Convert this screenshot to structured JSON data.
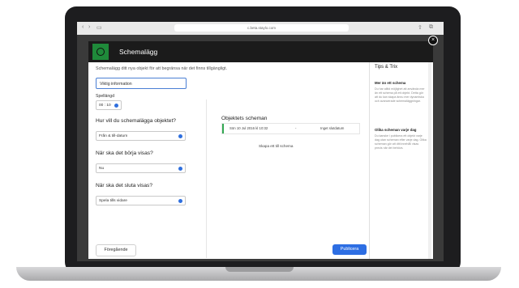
{
  "browser": {
    "address": "c.beta.staylo.com"
  },
  "modal": {
    "title": "Schemalägg",
    "intro": "Schemalägg ditt nya objekt för att begränsa när det finns tillgängligt.",
    "name_value": "Viktig information",
    "duration_label": "Spellängd",
    "duration_value": "00 : 10",
    "q1": "Hur vill du schemalägga objektet?",
    "q1_value": "Från & till-datum",
    "q2": "När ska det börja visas?",
    "q2_value": "Nu",
    "q3": "När ska det sluta visas?",
    "q3_value": "Spela tills vidare",
    "schedules_title": "Objektets scheman",
    "schedule_row": {
      "start": "Sön 10 Jul 2016 kl 10:32",
      "dash": "-",
      "end": "Inget slutdatum"
    },
    "add_schedule": "Skapa ett till schema",
    "prev_btn": "Föregående",
    "publish_btn": "Publicera",
    "accent": "#2d6ee3",
    "brand": "#1f8a3a"
  },
  "tips": {
    "title": "Tips & Trix",
    "h1": "Mer än ett schema",
    "b1": "Du har alltid möjlighet att använda mer än ett schema på ett objekt. Detta gör att du kan skapa ännu mer dynamiska och avancerade schemaläggningar.",
    "h2": "Olika scheman varje dag",
    "b2": "Du kanske i publicera ett objekt varje dag utan scheman efter varje dag. Olika scheman gör att ditt innehåll visas precis när det behövs."
  }
}
